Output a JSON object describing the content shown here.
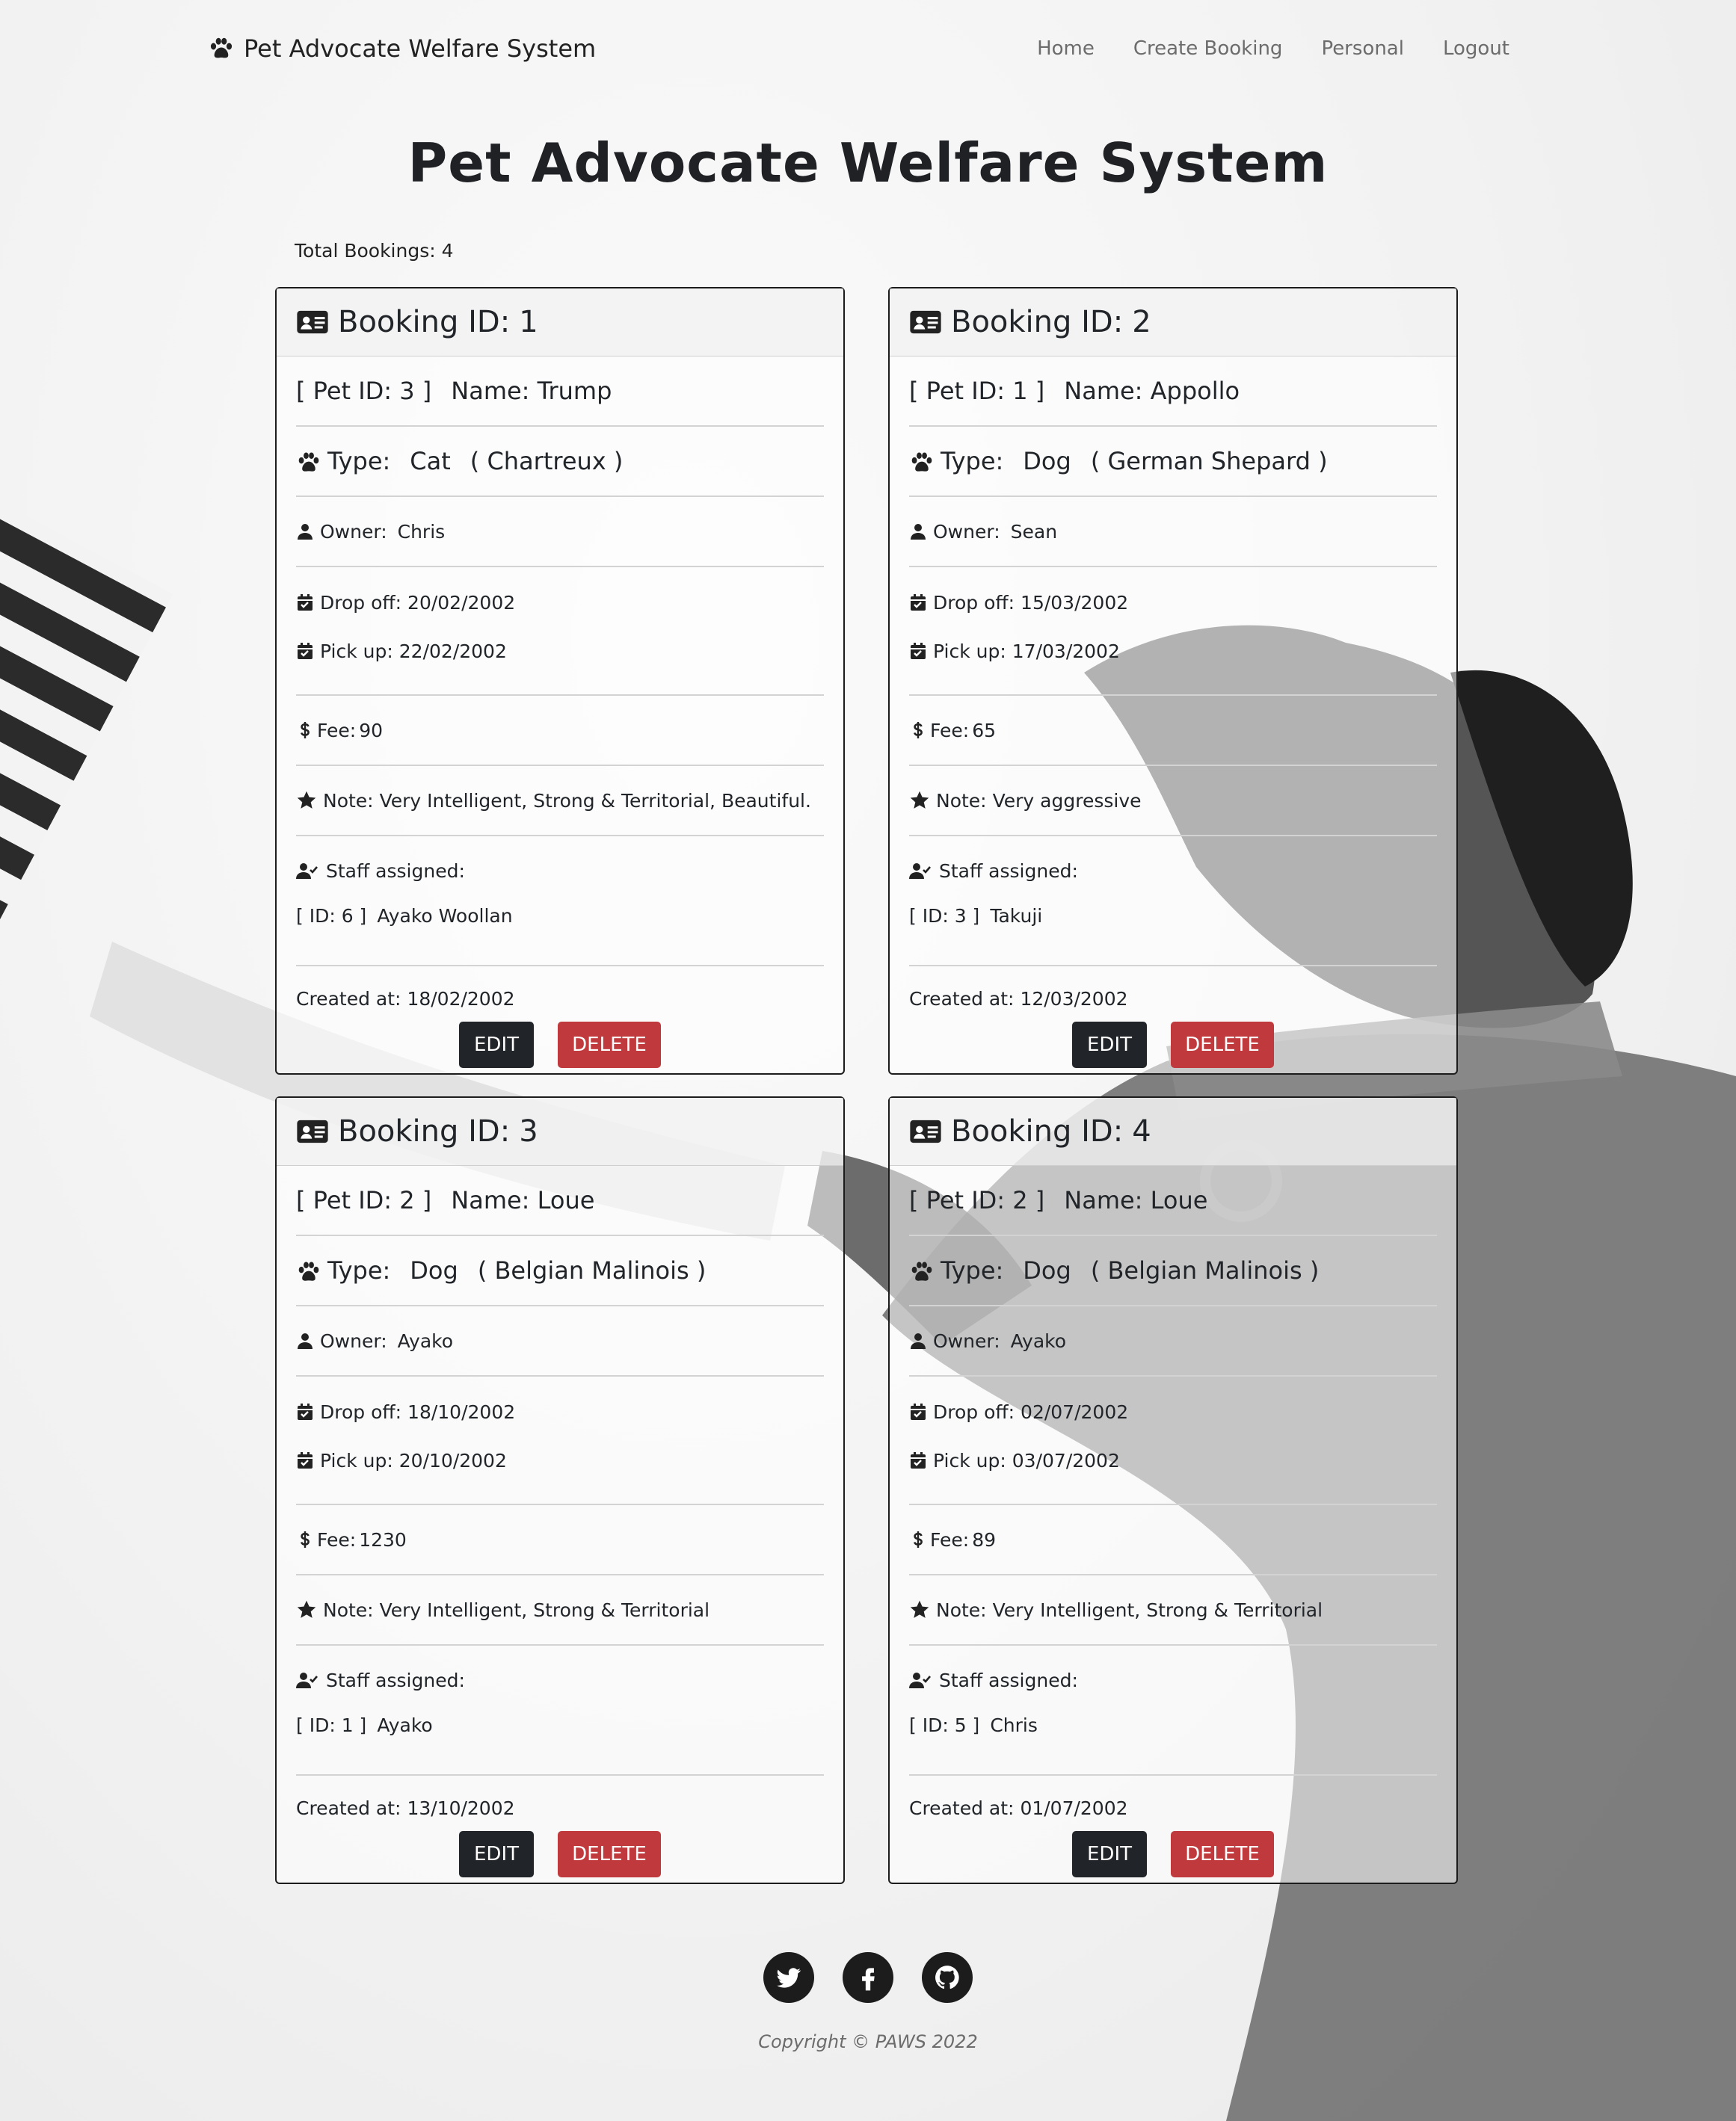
{
  "nav": {
    "brand": "Pet Advocate Welfare System",
    "links": [
      "Home",
      "Create Booking",
      "Personal",
      "Logout"
    ]
  },
  "page_title": "Pet Advocate Welfare System",
  "total_bookings": "Total Bookings: 4",
  "labels": {
    "booking_id": "Booking ID:",
    "type": "Type:",
    "owner": "Owner:",
    "drop_off": "Drop off:",
    "pick_up": "Pick up:",
    "fee": "Fee:",
    "note": "Note:",
    "staff": "Staff assigned:",
    "created": "Created at:",
    "edit": "EDIT",
    "delete": "DELETE"
  },
  "bookings": [
    {
      "id": "1",
      "pet_id": "[ Pet ID: 3 ]",
      "name": "Name: Trump",
      "type": "Cat",
      "breed": "( Chartreux )",
      "owner": "Chris",
      "drop_off": "20/02/2002",
      "pick_up": "22/02/2002",
      "fee": "90",
      "note": "Very Intelligent, Strong & Territorial, Beautiful.",
      "staff_id": "[ ID: 6 ]",
      "staff_name": "Ayako Woollan",
      "created": "18/02/2002"
    },
    {
      "id": "2",
      "pet_id": "[ Pet ID: 1 ]",
      "name": "Name: Appollo",
      "type": "Dog",
      "breed": "( German Shepard )",
      "owner": "Sean",
      "drop_off": "15/03/2002",
      "pick_up": "17/03/2002",
      "fee": "65",
      "note": "Very aggressive",
      "staff_id": "[ ID: 3 ]",
      "staff_name": "Takuji",
      "created": "12/03/2002"
    },
    {
      "id": "3",
      "pet_id": "[ Pet ID: 2 ]",
      "name": "Name: Loue",
      "type": "Dog",
      "breed": "( Belgian Malinois )",
      "owner": "Ayako",
      "drop_off": "18/10/2002",
      "pick_up": "20/10/2002",
      "fee": "1230",
      "note": "Very Intelligent, Strong & Territorial",
      "staff_id": "[ ID: 1 ]",
      "staff_name": "Ayako",
      "created": "13/10/2002"
    },
    {
      "id": "4",
      "pet_id": "[ Pet ID: 2 ]",
      "name": "Name: Loue",
      "type": "Dog",
      "breed": "( Belgian Malinois )",
      "owner": "Ayako",
      "drop_off": "02/07/2002",
      "pick_up": "03/07/2002",
      "fee": "89",
      "note": "Very Intelligent, Strong & Territorial",
      "staff_id": "[ ID: 5 ]",
      "staff_name": "Chris",
      "created": "01/07/2002"
    }
  ],
  "footer": {
    "icons": [
      "twitter-icon",
      "facebook-icon",
      "github-icon"
    ],
    "copyright": "Copyright © PAWS 2022"
  },
  "colors": {
    "edit": "#212529",
    "delete": "#c0393c",
    "text": "#212529"
  }
}
